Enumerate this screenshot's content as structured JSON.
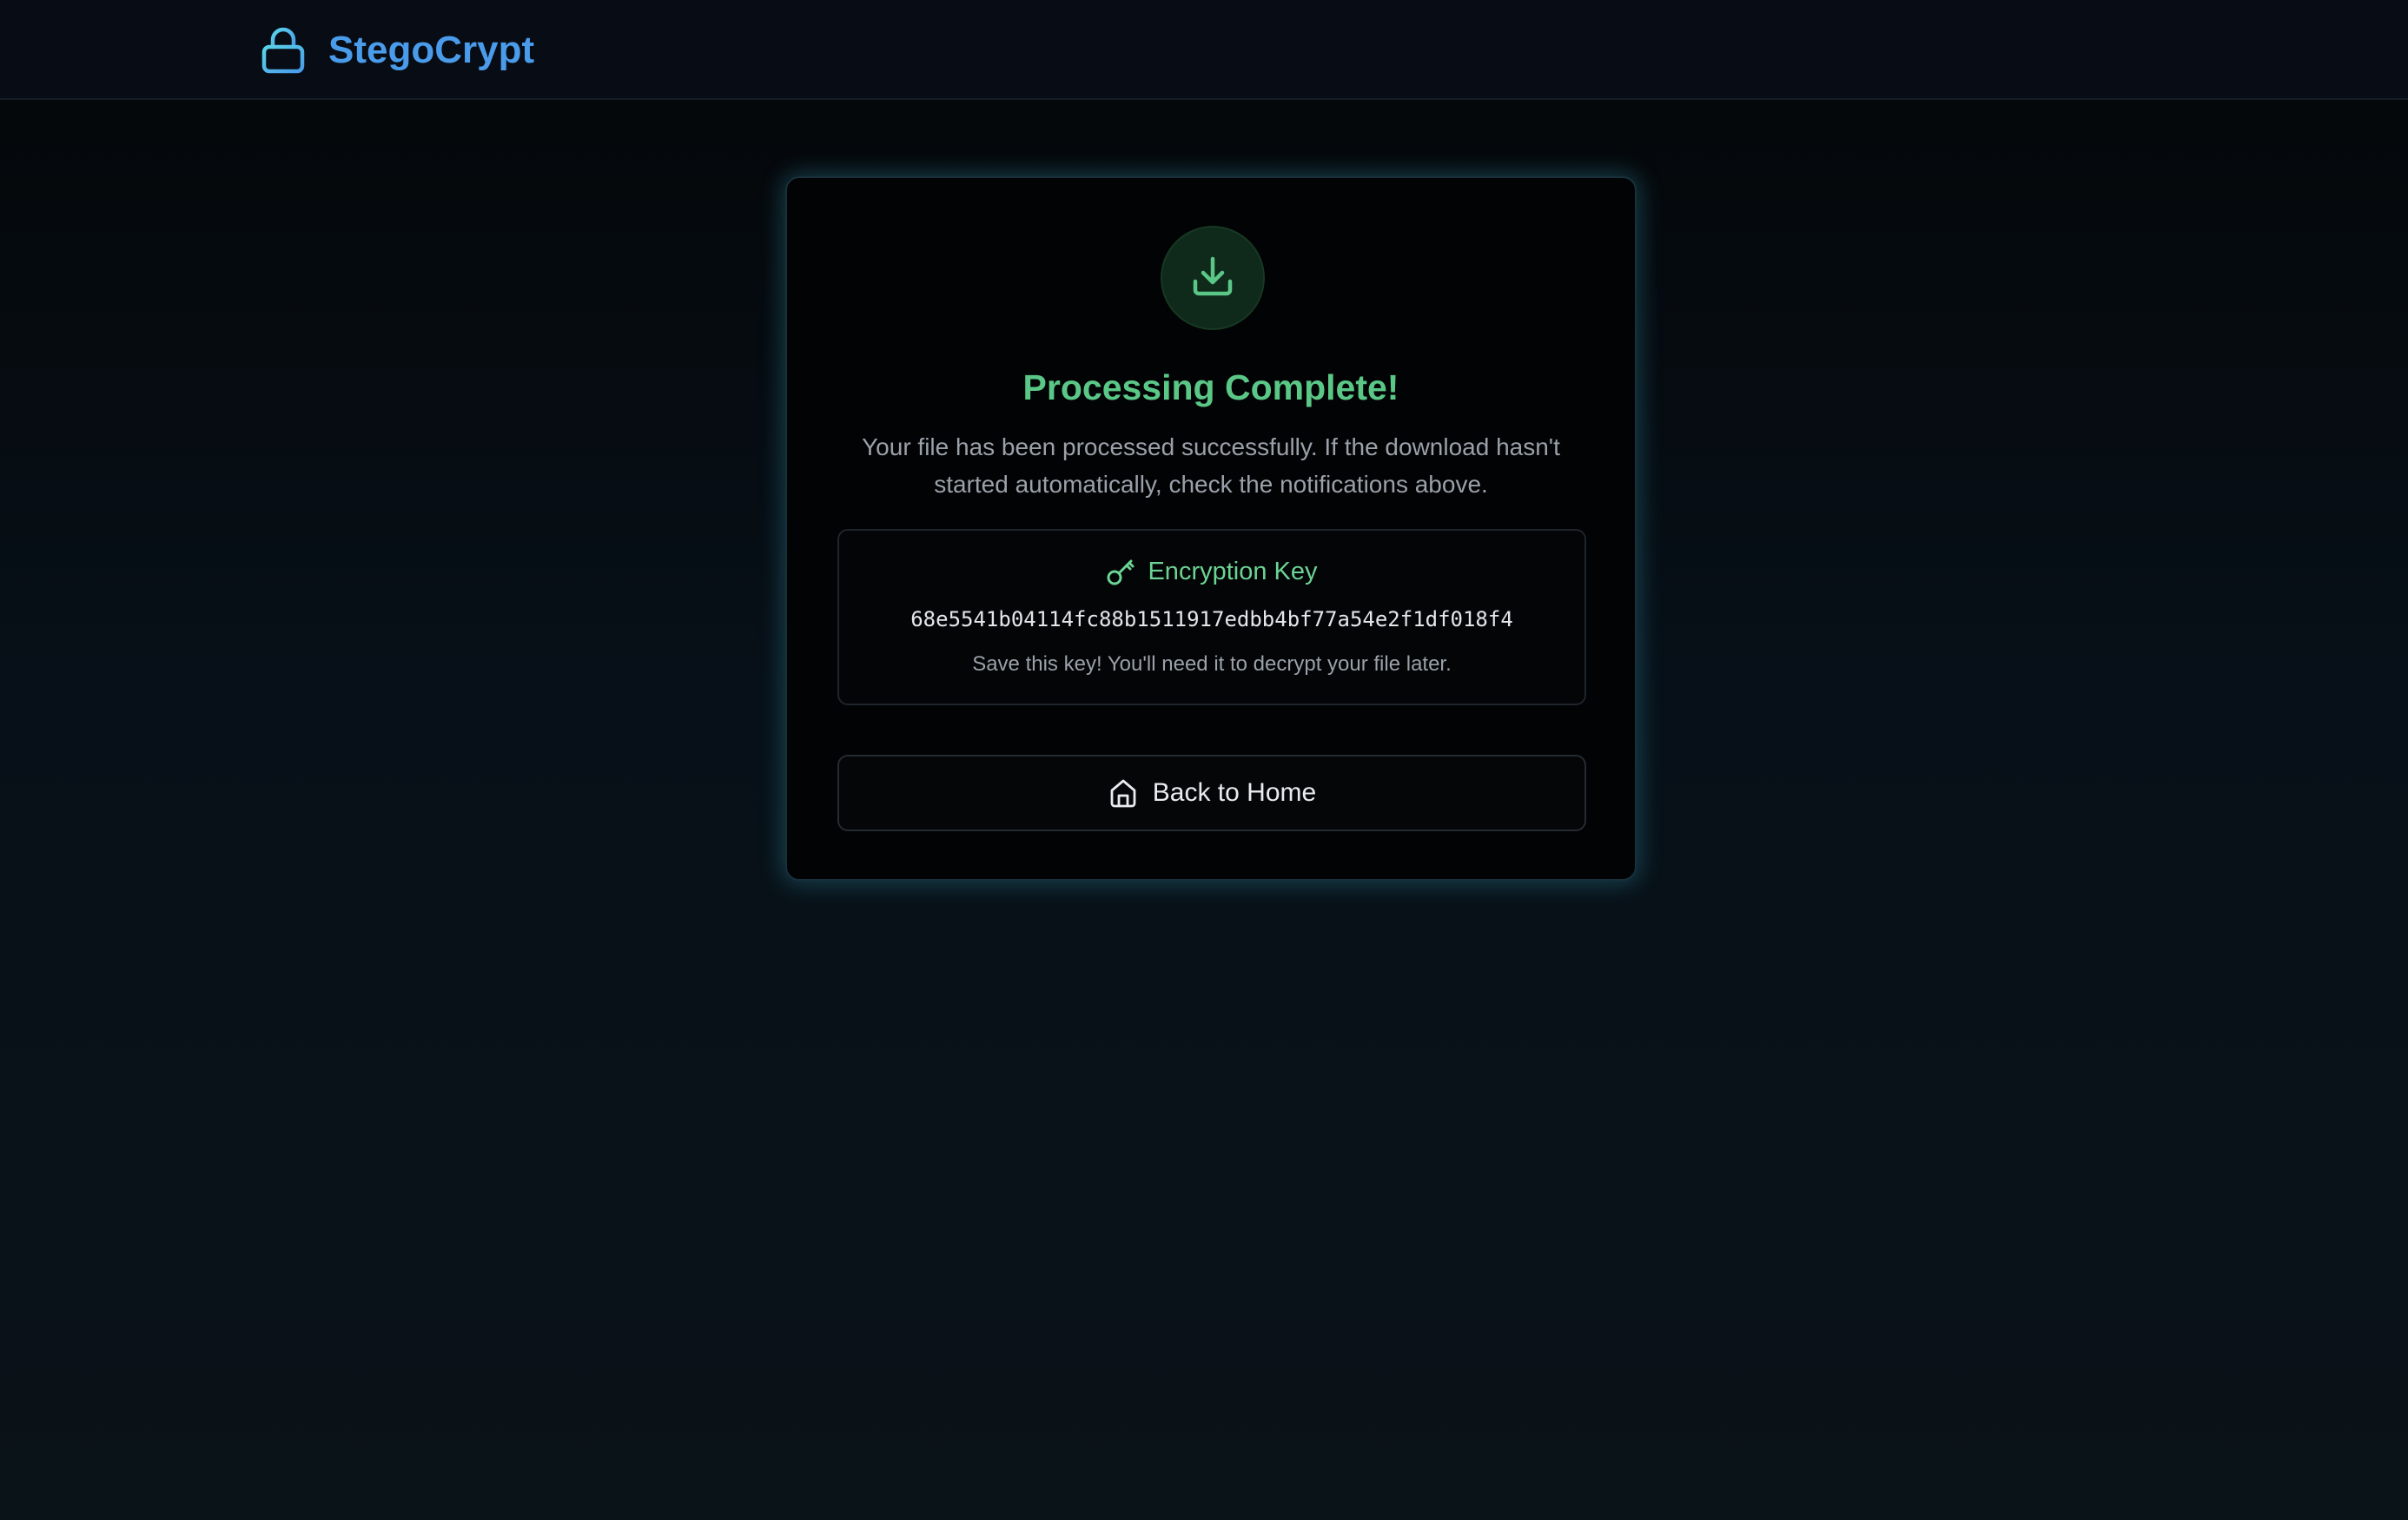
{
  "navbar": {
    "brand_name": "StegoCrypt",
    "brand_icon": "lock-icon",
    "brand_color": "#4a9bea"
  },
  "result_card": {
    "status_icon": "download-icon",
    "title": "Processing Complete!",
    "message": "Your file has been processed successfully. If the download hasn't started automatically, check the notifications above.",
    "accent_color": "#5bc787",
    "key_panel": {
      "icon": "key-icon",
      "label": "Encryption Key",
      "value": "68e5541b04114fc88b1511917edbb4bf77a54e2f1df018f4",
      "note": "Save this key! You'll need it to decrypt your file later."
    },
    "home_button": {
      "icon": "home-icon",
      "label": "Back to Home"
    }
  }
}
